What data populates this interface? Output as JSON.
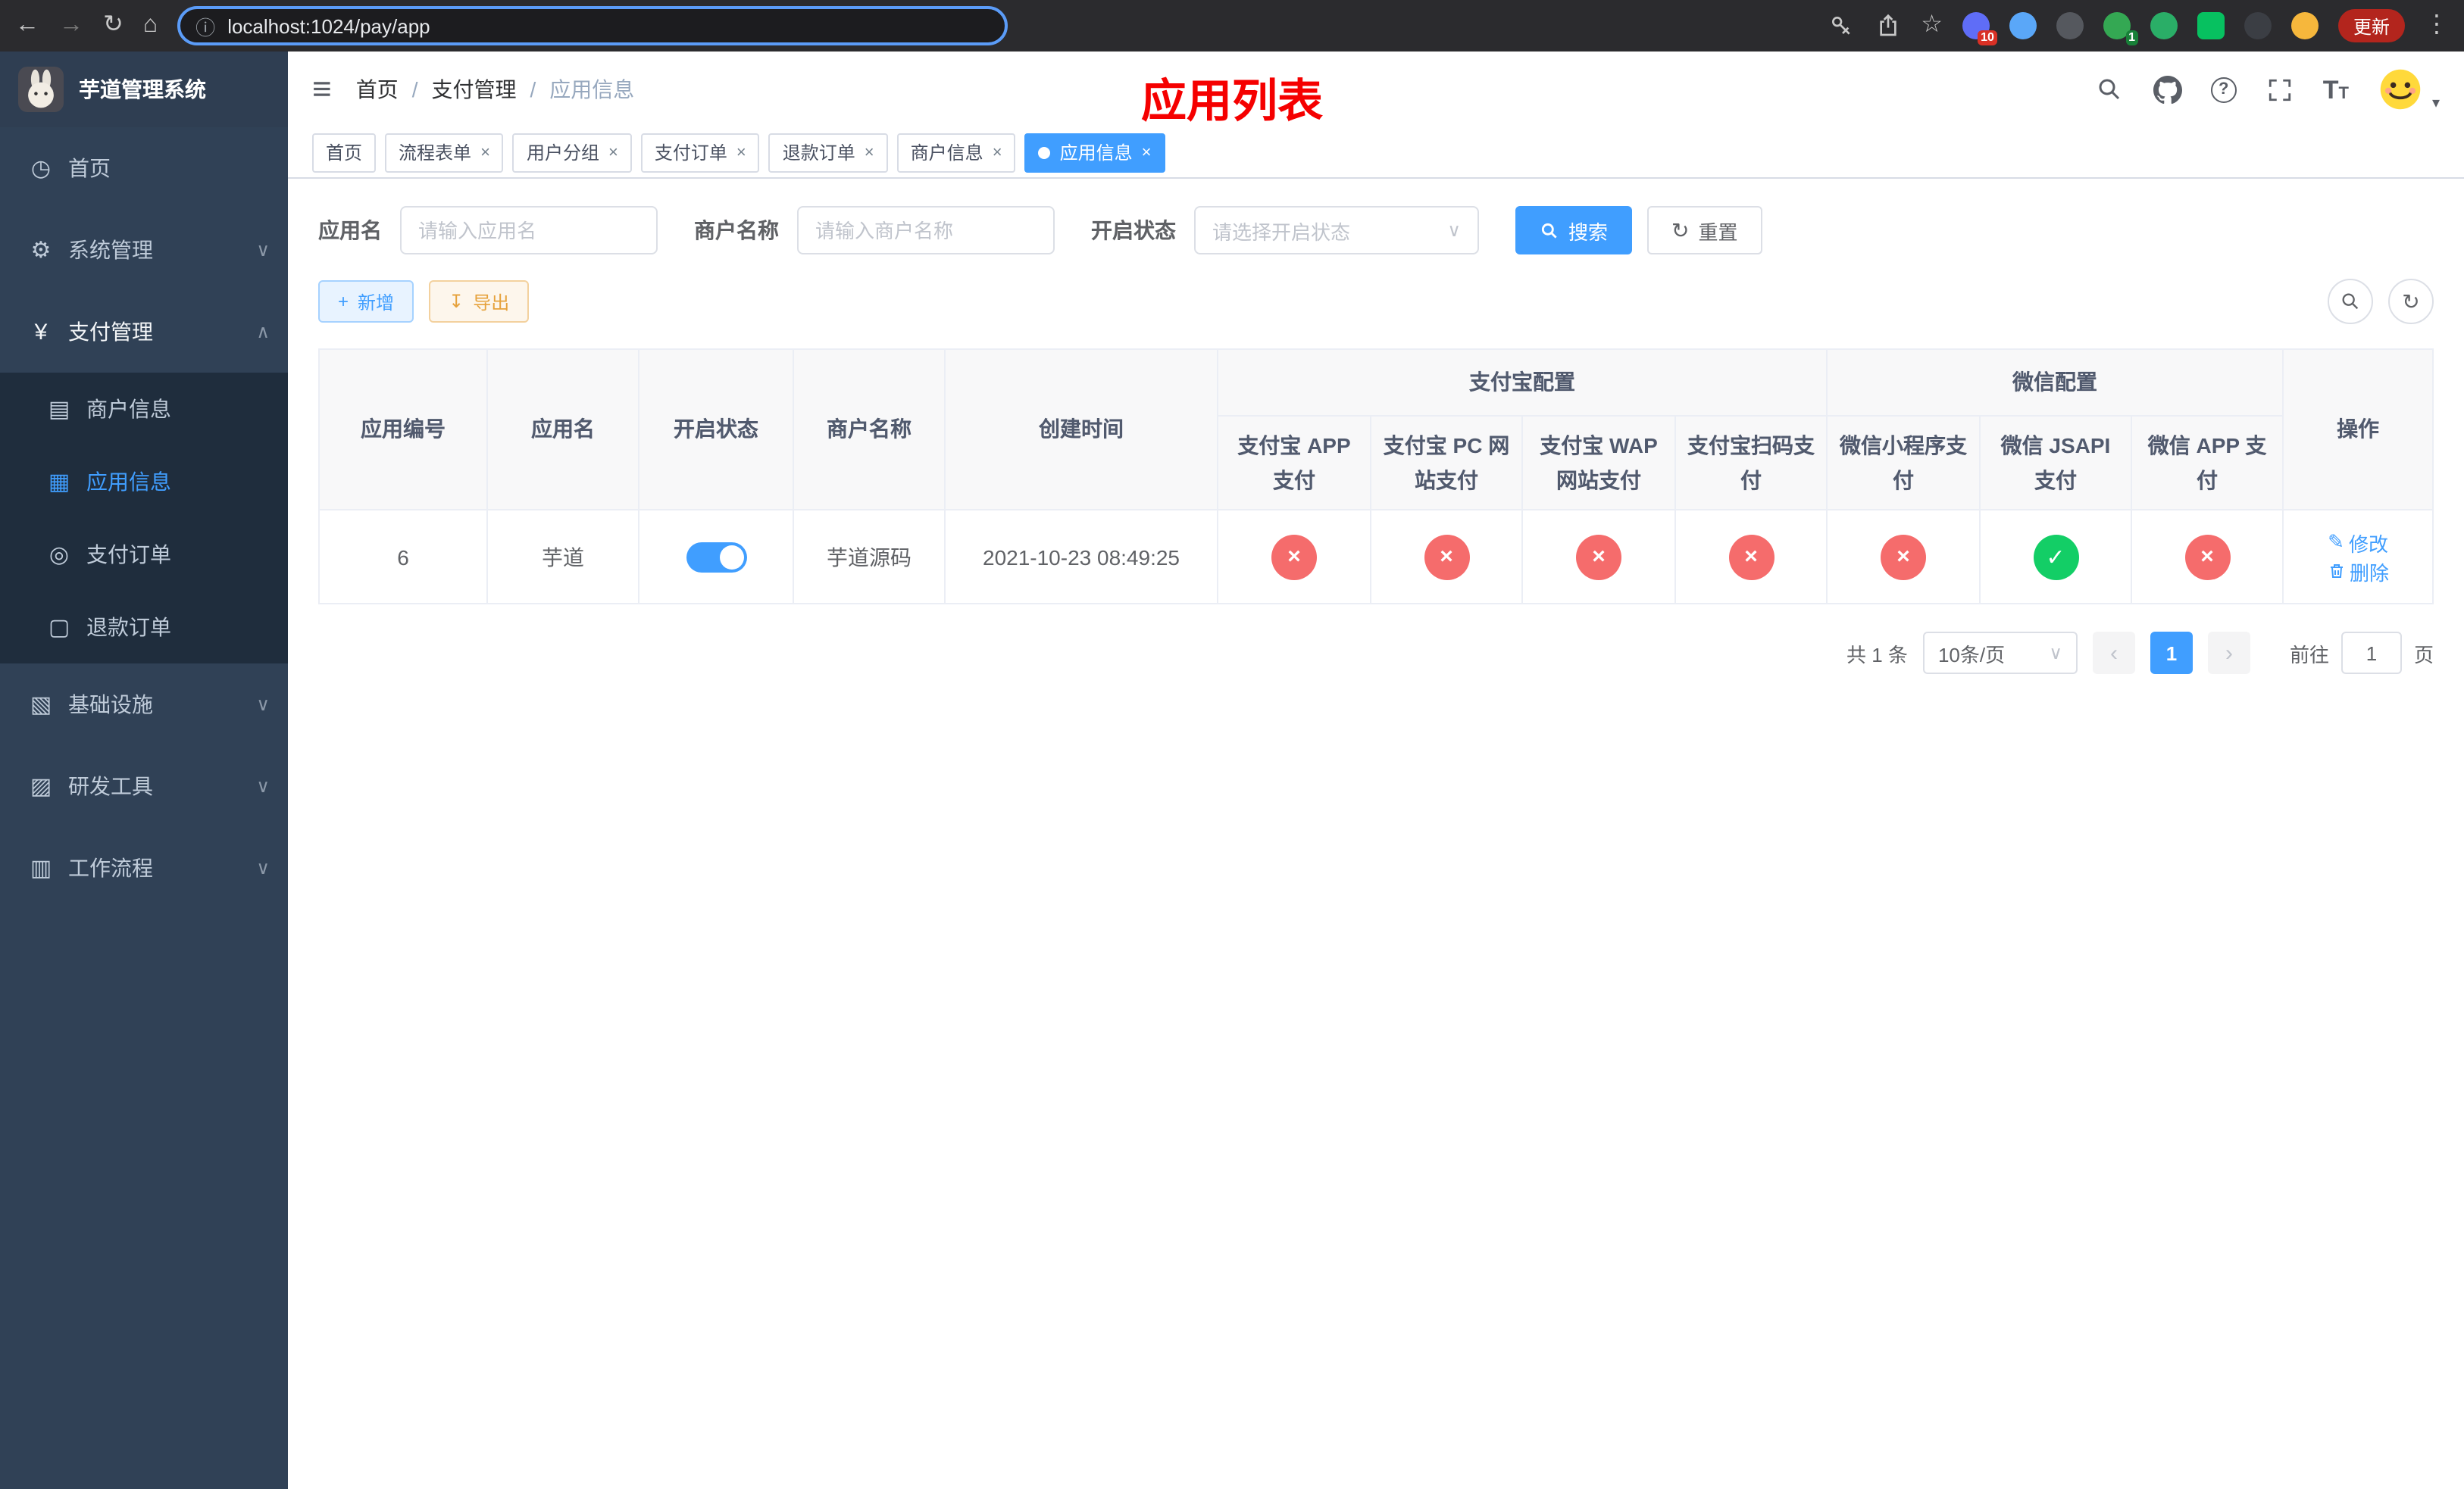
{
  "colors": {
    "primary": "#409eff",
    "danger": "#f56c6c",
    "success": "#13ce66",
    "warning": "#e6a23c",
    "banner_red": "#f50000",
    "sidebar_bg": "#304156",
    "submenu_bg": "#1f2d3d"
  },
  "icons": {
    "back": "←",
    "forward": "→",
    "refresh": "↻",
    "home": "⌂",
    "info": "ⓘ",
    "star": "☆",
    "menu_dots": "⋮",
    "hamburger": "≡",
    "breadcrumb_sep": "/",
    "chevron_down": "∨",
    "chevron_up": "∧",
    "caret_down": "▾",
    "question": "?",
    "font_size": "T",
    "dashboard": "◷",
    "gear": "⚙",
    "yen": "¥",
    "merchant": "▤",
    "app": "▦",
    "order": "◎",
    "refund": "▢",
    "infra": "▧",
    "tools": "▨",
    "workflow": "▥",
    "plus": "+",
    "download": "↧",
    "reset": "↻",
    "close": "×",
    "check": "✓",
    "edit": "✎",
    "prev": "‹",
    "next": "›"
  },
  "browser": {
    "url": "localhost:1024/pay/app",
    "update_label": "更新",
    "ext_badge_1": "10",
    "ext_badge_2": "1"
  },
  "sidebar": {
    "title": "芋道管理系统",
    "items": [
      {
        "label": "首页"
      },
      {
        "label": "系统管理"
      },
      {
        "label": "支付管理"
      },
      {
        "label": "商户信息"
      },
      {
        "label": "应用信息"
      },
      {
        "label": "支付订单"
      },
      {
        "label": "退款订单"
      },
      {
        "label": "基础设施"
      },
      {
        "label": "研发工具"
      },
      {
        "label": "工作流程"
      }
    ]
  },
  "navbar": {
    "breadcrumb": {
      "home": "首页",
      "section": "支付管理",
      "current": "应用信息"
    },
    "banner": "应用列表"
  },
  "tabs": [
    {
      "label": "首页"
    },
    {
      "label": "流程表单"
    },
    {
      "label": "用户分组"
    },
    {
      "label": "支付订单"
    },
    {
      "label": "退款订单"
    },
    {
      "label": "商户信息"
    },
    {
      "label": "应用信息"
    }
  ],
  "filters": {
    "app_name_label": "应用名",
    "app_name_placeholder": "请输入应用名",
    "merchant_label": "商户名称",
    "merchant_placeholder": "请输入商户名称",
    "status_label": "开启状态",
    "status_placeholder": "请选择开启状态",
    "search_label": "搜索",
    "reset_label": "重置"
  },
  "toolbar": {
    "add_label": "新增",
    "export_label": "导出"
  },
  "table": {
    "headers": {
      "app_id": "应用编号",
      "app_name": "应用名",
      "status": "开启状态",
      "merchant": "商户名称",
      "create_time": "创建时间",
      "alipay_group": "支付宝配置",
      "wechat_group": "微信配置",
      "alipay_app": "支付宝 APP 支付",
      "alipay_pc": "支付宝 PC 网站支付",
      "alipay_wap": "支付宝 WAP 网站支付",
      "alipay_qr": "支付宝扫码支付",
      "wx_lite": "微信小程序支付",
      "wx_jsapi": "微信 JSAPI 支付",
      "wx_app": "微信 APP 支付",
      "actions": "操作"
    },
    "rows": [
      {
        "app_id": "6",
        "app_name": "芋道",
        "status_enabled": true,
        "merchant": "芋道源码",
        "create_time": "2021-10-23 08:49:25",
        "channels": {
          "alipay_app": false,
          "alipay_pc": false,
          "alipay_wap": false,
          "alipay_qr": false,
          "wx_lite": false,
          "wx_jsapi": true,
          "wx_app": false
        },
        "edit_label": "修改",
        "delete_label": "删除"
      }
    ]
  },
  "pagination": {
    "total_text": "共 1 条",
    "page_size": "10条/页",
    "current_page": "1",
    "goto_prefix": "前往",
    "goto_value": "1",
    "goto_suffix": "页"
  }
}
